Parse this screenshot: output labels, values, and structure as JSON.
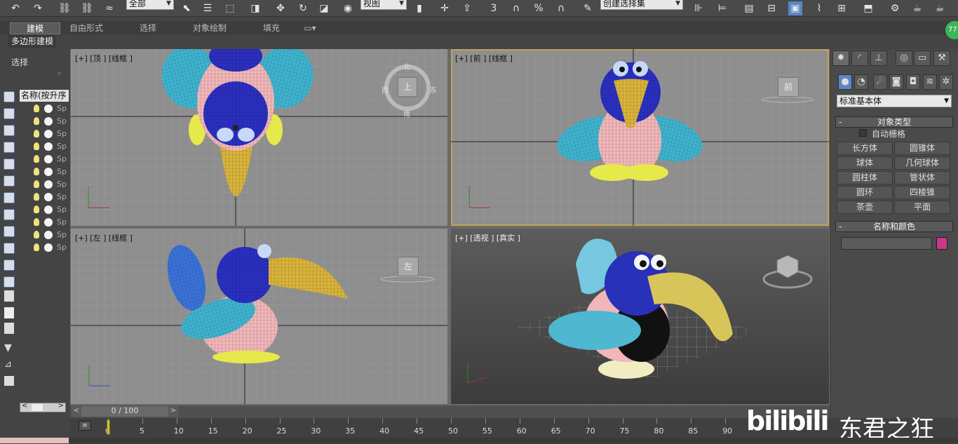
{
  "toolbar": {
    "selection_filter": "全部",
    "ref_coord": "视图",
    "named_selection": "创建选择集",
    "percent_label": "%",
    "snap_label": "3"
  },
  "ribbon": {
    "tabs": [
      "建模",
      "自由形式",
      "选择",
      "对象绘制",
      "填充"
    ],
    "active_tab": 0,
    "subtab": "多边形建模"
  },
  "scene_explorer": {
    "select_label": "选择",
    "column_header": "名称(按升序",
    "rows": [
      "Sp",
      "Sp",
      "Sp",
      "Sp",
      "Sp",
      "Sp",
      "Sp",
      "Sp",
      "Sp",
      "Sp",
      "Sp",
      "Sp"
    ]
  },
  "viewports": {
    "top": "[+] [顶 ] [线框 ]",
    "front": "[+] [前 ] [线框 ]",
    "left": "[+] [左 ] [线框 ]",
    "perspective": "[+] [透视 ] [真实 ]",
    "cube_top": "上",
    "cube_top_north": "北",
    "cube_top_south": "南",
    "cube_top_west": "西",
    "cube_top_east": "东",
    "cube_front": "前",
    "cube_left": "左"
  },
  "command_panel": {
    "category": "标准基本体",
    "object_type_title": "对象类型",
    "autogrid": "自动栅格",
    "buttons": [
      "长方体",
      "圆锥体",
      "球体",
      "几何球体",
      "圆柱体",
      "管状体",
      "圆环",
      "四棱锥",
      "茶壶",
      "平面"
    ],
    "name_color_title": "名称和颜色",
    "swatch_color": "#c9378a"
  },
  "timeline": {
    "frame_label": "0 / 100",
    "prev": "<",
    "next": ">",
    "ticks": [
      "0",
      "5",
      "10",
      "15",
      "20",
      "25",
      "30",
      "35",
      "40",
      "45",
      "50",
      "55",
      "60",
      "65",
      "70",
      "75",
      "80",
      "85",
      "90"
    ]
  },
  "watermark": {
    "logo": "bilibili",
    "author": "东君之狂"
  },
  "colors": {
    "viewport_bg": "#8e8e8e",
    "active_border": "#c8a64b",
    "beak": "#d8b33a",
    "wing": "#3fb3cf",
    "head": "#2a2fbf",
    "body": "#f0b6b8",
    "feet": "#e6e94a"
  },
  "badge": "77"
}
